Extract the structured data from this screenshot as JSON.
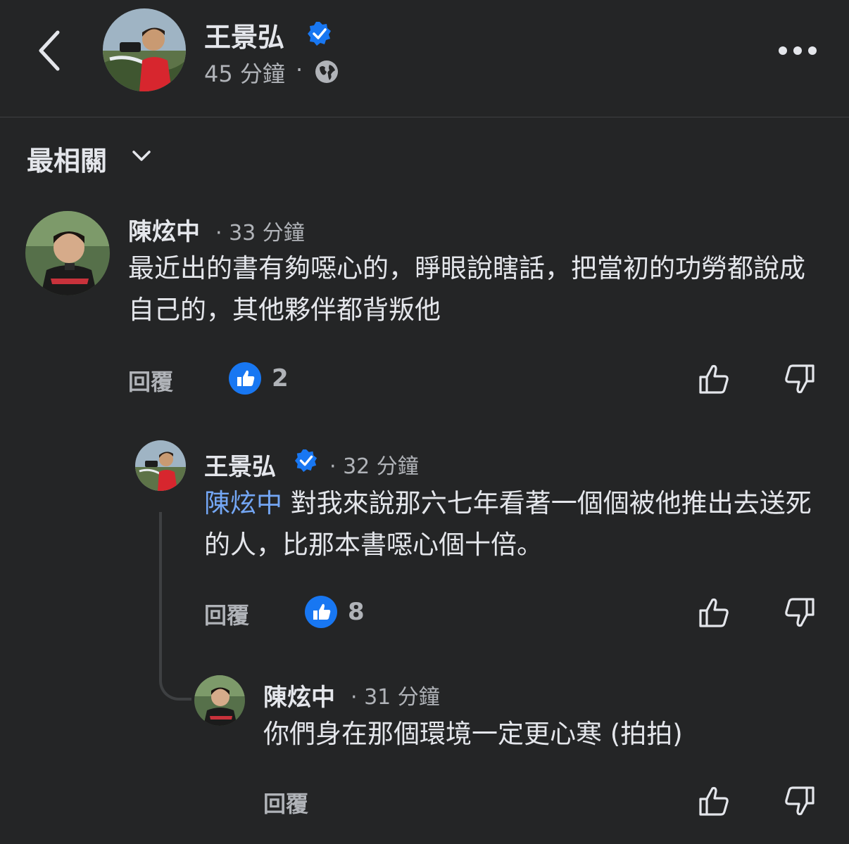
{
  "header": {
    "back_icon": "chevron-left-icon",
    "name": "王景弘",
    "verified_icon": "verified-badge-icon",
    "time": "45 分鐘",
    "dot": "·",
    "privacy_icon": "globe-icon",
    "more_icon": "more-horizontal-icon"
  },
  "sort": {
    "label": "最相關",
    "chevron_icon": "chevron-down-icon"
  },
  "comments": [
    {
      "author": "陳炫中",
      "time": "· 33 分鐘",
      "text": "最近出的書有夠噁心的，睜眼說瞎話，把當初的功勞都說成自己的，其他夥伴都背叛他",
      "reply_label": "回覆",
      "like_count": "2"
    },
    {
      "author": "王景弘",
      "time": "· 32 分鐘",
      "mention": "陳炫中",
      "text": " 對我來說那六七年看著一個個被他推出去送死的人，比那本書噁心個十倍。",
      "reply_label": "回覆",
      "like_count": "8"
    },
    {
      "author": "陳炫中",
      "time": "· 31 分鐘",
      "text": "你們身在那個環境一定更心寒 (拍拍)",
      "reply_label": "回覆"
    }
  ],
  "colors": {
    "background": "#242526",
    "text": "#e4e6eb",
    "secondary": "#b0b3b8",
    "mention": "#74a7f5",
    "like_blue": "#1877f2"
  }
}
